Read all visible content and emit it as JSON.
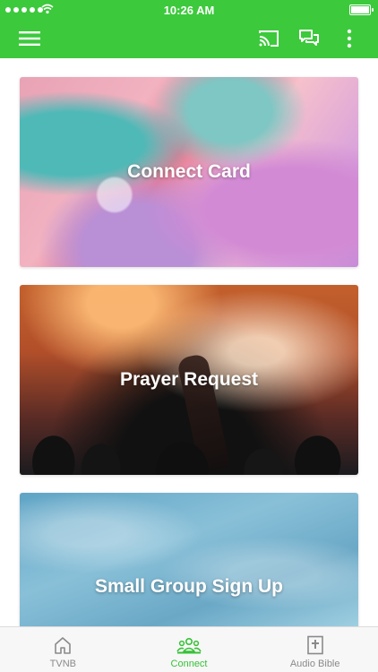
{
  "status_bar": {
    "time": "10:26 AM"
  },
  "app_bar": {
    "menu_icon": "hamburger-menu-icon",
    "actions": [
      "cast-icon",
      "chat-icon",
      "more-vert-icon"
    ],
    "color": "#3cc93c"
  },
  "cards": [
    {
      "title": "Connect Card"
    },
    {
      "title": "Prayer Request"
    },
    {
      "title": "Small Group Sign Up"
    }
  ],
  "tabs": [
    {
      "label": "TVNB",
      "icon": "home-icon",
      "active": false
    },
    {
      "label": "Connect",
      "icon": "people-icon",
      "active": true
    },
    {
      "label": "Audio Bible",
      "icon": "bible-icon",
      "active": false
    }
  ],
  "colors": {
    "accent": "#3cc93c",
    "tab_active": "#36c136",
    "tab_inactive": "#8a8a8a"
  }
}
